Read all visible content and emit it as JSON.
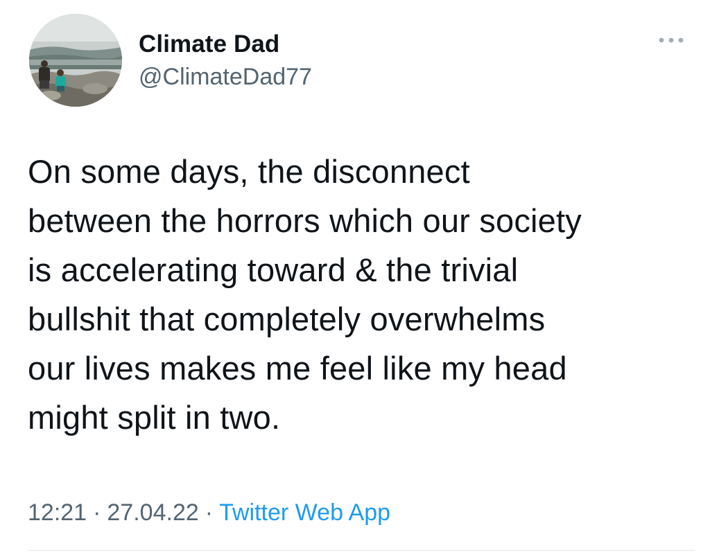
{
  "tweet": {
    "author": {
      "display_name": "Climate Dad",
      "handle": "@ClimateDad77",
      "avatar_icon": "profile-photo"
    },
    "more_icon": "more-options-icon",
    "text": "On some days, the disconnect\nbetween the horrors which our society\nis accelerating toward & the trivial\nbullshit that completely overwhelms\nour lives makes me feel like my head\nmight split in two.",
    "time": "12:21",
    "separator": "·",
    "date": "27.04.22",
    "source": "Twitter Web App"
  },
  "colors": {
    "text": "#0f1419",
    "secondary": "#536471",
    "link": "#1d9bf0",
    "divider": "#e6e9eb"
  }
}
